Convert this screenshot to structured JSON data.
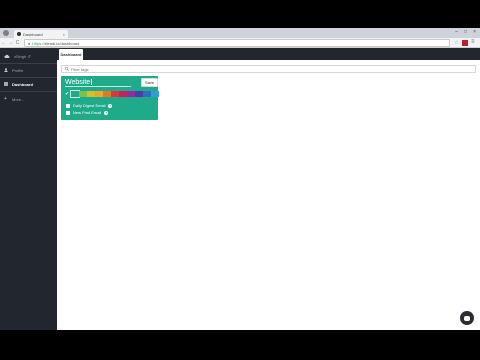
{
  "browser": {
    "tab_title": "Dashboard",
    "tab_close": "×",
    "url_scheme": "https://",
    "url_rest": "steadi.io/dashboard",
    "window_controls": [
      "–",
      "□",
      "×"
    ],
    "nav": {
      "back": "←",
      "forward": "→",
      "reload": "C"
    }
  },
  "sidebar": {
    "items": [
      {
        "label": "zSingh  ↺",
        "icon": "cloud-icon"
      },
      {
        "label": "Profile",
        "icon": "user-icon"
      },
      {
        "label": "Dashboard",
        "icon": "dashboard-icon"
      },
      {
        "label": "More...",
        "icon": "plus-icon"
      }
    ]
  },
  "main": {
    "tab": "Dashboard",
    "filter_placeholder": "Filter tags",
    "card": {
      "title": "Website",
      "save": "Save",
      "accent": "#1faa8a",
      "colors": [
        "#1faa8a",
        "#7cc24a",
        "#d6c02c",
        "#e8a82a",
        "#e5772c",
        "#d63a3a",
        "#c22366",
        "#8e2ea0",
        "#4b3ea6",
        "#2f6ec0",
        "#2aa0d6"
      ],
      "options": [
        {
          "label": "Daily Digest Email"
        },
        {
          "label": "New Post Email"
        }
      ]
    }
  }
}
